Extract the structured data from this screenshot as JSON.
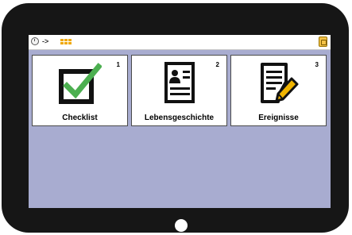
{
  "statusbar": {
    "arrow": "->",
    "icons": [
      "clock-icon",
      "app-grid-icon",
      "settings-icon"
    ]
  },
  "tiles": [
    {
      "label": "Checklist",
      "number": "1",
      "icon": "checklist-icon"
    },
    {
      "label": "Lebensgeschichte",
      "number": "2",
      "icon": "profile-card-icon"
    },
    {
      "label": "Ereignisse",
      "number": "3",
      "icon": "notes-pencil-icon"
    }
  ],
  "colors": {
    "screen_background": "#a8acd0",
    "check_green": "#4caf50",
    "accent_yellow": "#f0a800",
    "device_frame": "#161616"
  }
}
